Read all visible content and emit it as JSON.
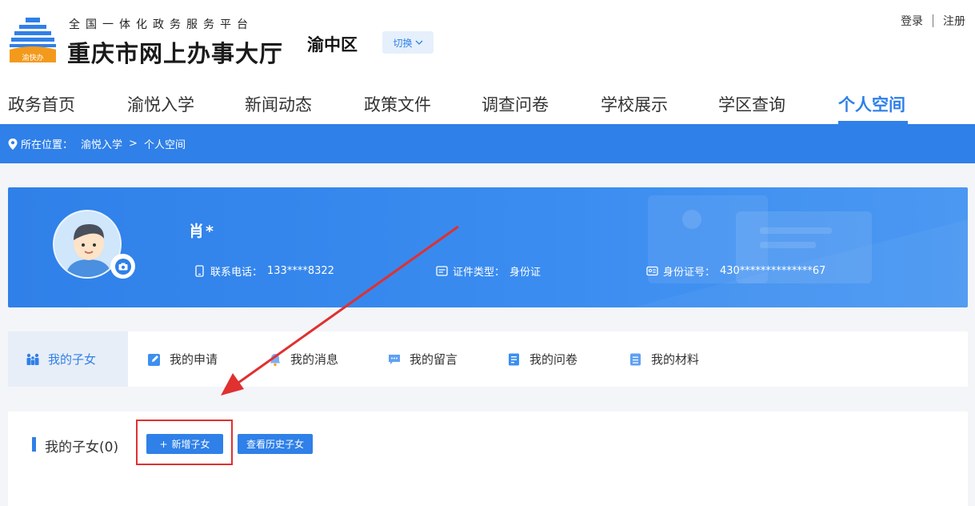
{
  "header": {
    "logo_badge": "渝快办",
    "subtitle": "全国一体化政务服务平台",
    "title": "重庆市网上办事大厅",
    "district": "渝中区",
    "switch_label": "切换",
    "login": "登录",
    "register": "注册"
  },
  "nav": {
    "items": [
      {
        "label": "政务首页"
      },
      {
        "label": "渝悦入学"
      },
      {
        "label": "新闻动态"
      },
      {
        "label": "政策文件"
      },
      {
        "label": "调查问卷"
      },
      {
        "label": "学校展示"
      },
      {
        "label": "学区查询"
      },
      {
        "label": "个人空间",
        "active": true
      }
    ]
  },
  "breadcrumb": {
    "prefix": "所在位置：",
    "path": [
      "渝悦入学",
      "个人空间"
    ],
    "separator": ">"
  },
  "profile": {
    "name": "肖*",
    "phone_label": "联系电话：",
    "phone_value": "133****8322",
    "cert_type_label": "证件类型：",
    "cert_type_value": "身份证",
    "id_label": "身份证号：",
    "id_value": "430**************67"
  },
  "tabs": [
    {
      "label": "我的子女",
      "icon": "family-icon",
      "active": true
    },
    {
      "label": "我的申请",
      "icon": "edit-icon"
    },
    {
      "label": "我的消息",
      "icon": "bell-icon"
    },
    {
      "label": "我的留言",
      "icon": "chat-icon"
    },
    {
      "label": "我的问卷",
      "icon": "survey-icon"
    },
    {
      "label": "我的材料",
      "icon": "document-icon"
    }
  ],
  "children_panel": {
    "title": "我的子女",
    "count": "(0)",
    "add_button": "新增子女",
    "history_button": "查看历史子女"
  },
  "colors": {
    "primary": "#2f80e8",
    "annotation_red": "#e03030"
  }
}
